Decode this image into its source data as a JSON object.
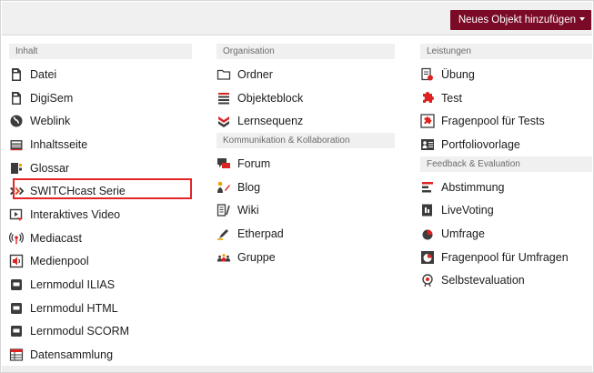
{
  "toolbar": {
    "add_button_label": "Neues Objekt hinzufügen"
  },
  "columns": {
    "col1": {
      "sections": [
        {
          "title": "Inhalt",
          "items": [
            {
              "label": "Datei",
              "icon": "file-icon"
            },
            {
              "label": "DigiSem",
              "icon": "file-icon"
            },
            {
              "label": "Weblink",
              "icon": "globe-icon"
            },
            {
              "label": "Inhaltsseite",
              "icon": "page-icon"
            },
            {
              "label": "Glossar",
              "icon": "glossary-icon"
            },
            {
              "label": "SWITCHcast Serie",
              "icon": "switchcast-icon"
            },
            {
              "label": "Interaktives Video",
              "icon": "interactive-video-icon"
            },
            {
              "label": "Mediacast",
              "icon": "broadcast-icon"
            },
            {
              "label": "Medienpool",
              "icon": "speaker-icon"
            },
            {
              "label": "Lernmodul ILIAS",
              "icon": "module-icon"
            },
            {
              "label": "Lernmodul HTML",
              "icon": "module-icon"
            },
            {
              "label": "Lernmodul SCORM",
              "icon": "module-icon"
            },
            {
              "label": "Datensammlung",
              "icon": "table-icon"
            }
          ]
        }
      ]
    },
    "col2": {
      "sections": [
        {
          "title": "Organisation",
          "items": [
            {
              "label": "Ordner",
              "icon": "folder-icon"
            },
            {
              "label": "Objekteblock",
              "icon": "list-icon"
            },
            {
              "label": "Lernsequenz",
              "icon": "chevrons-icon"
            }
          ]
        },
        {
          "title": "Kommunikation & Kollaboration",
          "items": [
            {
              "label": "Forum",
              "icon": "forum-icon"
            },
            {
              "label": "Blog",
              "icon": "blog-icon"
            },
            {
              "label": "Wiki",
              "icon": "wiki-icon"
            },
            {
              "label": "Etherpad",
              "icon": "pen-icon"
            },
            {
              "label": "Gruppe",
              "icon": "group-icon"
            }
          ]
        }
      ]
    },
    "col3": {
      "sections": [
        {
          "title": "Leistungen",
          "items": [
            {
              "label": "Übung",
              "icon": "exercise-icon"
            },
            {
              "label": "Test",
              "icon": "puzzle-icon"
            },
            {
              "label": "Fragenpool für Tests",
              "icon": "puzzle-box-icon"
            },
            {
              "label": "Portfoliovorlage",
              "icon": "portfolio-icon"
            }
          ]
        },
        {
          "title": "Feedback & Evaluation",
          "items": [
            {
              "label": "Abstimmung",
              "icon": "bars-icon"
            },
            {
              "label": "LiveVoting",
              "icon": "voting-icon"
            },
            {
              "label": "Umfrage",
              "icon": "pie-icon"
            },
            {
              "label": "Fragenpool für Umfragen",
              "icon": "pie-box-icon"
            },
            {
              "label": "Selbstevaluation",
              "icon": "self-eval-icon"
            }
          ]
        }
      ]
    }
  },
  "highlighted_item": "SWITCHcast Serie"
}
